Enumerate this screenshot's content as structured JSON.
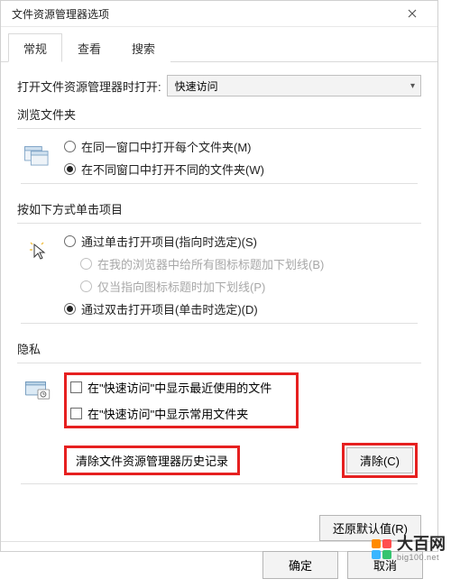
{
  "titlebar": {
    "title": "文件资源管理器选项"
  },
  "tabs": {
    "general": "常规",
    "view": "查看",
    "search": "搜索"
  },
  "open_in": {
    "label": "打开文件资源管理器时打开:",
    "value": "快速访问"
  },
  "browse": {
    "title": "浏览文件夹",
    "opt_same": "在同一窗口中打开每个文件夹(M)",
    "opt_new": "在不同窗口中打开不同的文件夹(W)"
  },
  "click": {
    "title": "按如下方式单击项目",
    "opt_single": "通过单击打开项目(指向时选定)(S)",
    "opt_under_browser": "在我的浏览器中给所有图标标题加下划线(B)",
    "opt_under_point": "仅当指向图标标题时加下划线(P)",
    "opt_double": "通过双击打开项目(单击时选定)(D)"
  },
  "privacy": {
    "title": "隐私",
    "chk_recent": "在\"快速访问\"中显示最近使用的文件",
    "chk_freq": "在\"快速访问\"中显示常用文件夹",
    "clear_label": "清除文件资源管理器历史记录",
    "clear_btn": "清除(C)"
  },
  "restore": "还原默认值(R)",
  "footer": {
    "ok": "确定",
    "cancel": "取消"
  },
  "watermark": {
    "name": "大百网",
    "url": "big100.net"
  }
}
